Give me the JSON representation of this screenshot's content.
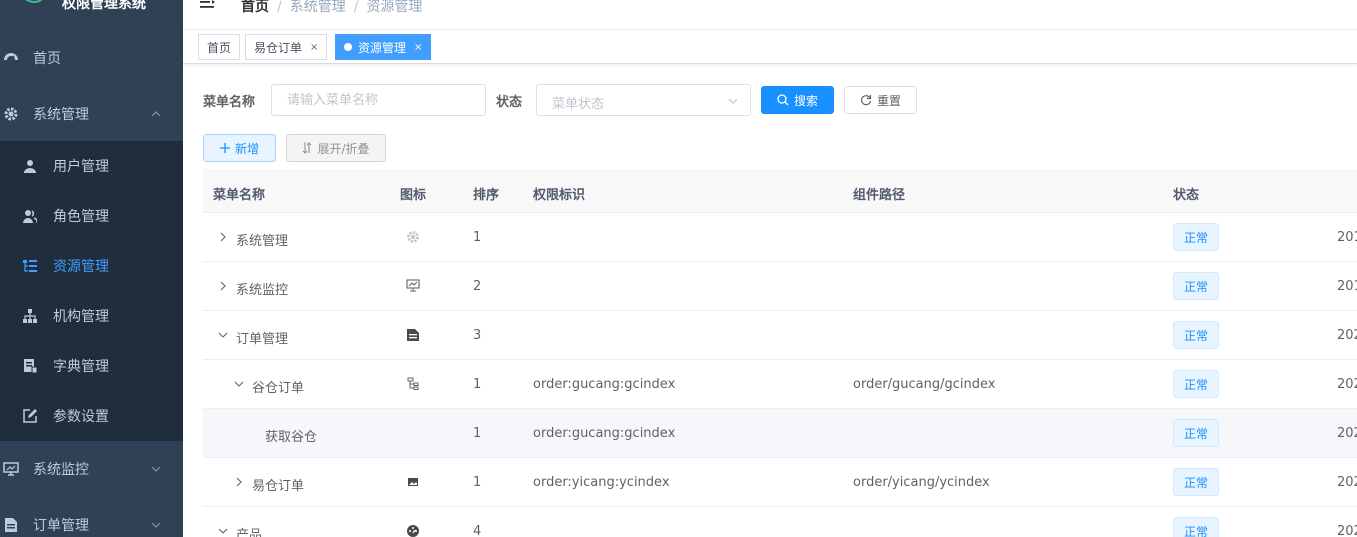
{
  "app": {
    "title": "权限管理系统"
  },
  "sidebar": {
    "items": [
      {
        "label": "首页",
        "icon": "dashboard-icon"
      },
      {
        "label": "系统管理",
        "icon": "gear-icon",
        "expanded": true
      },
      {
        "label": "系统监控",
        "icon": "monitor-icon"
      },
      {
        "label": "订单管理",
        "icon": "document-icon"
      }
    ],
    "submenu": [
      {
        "label": "用户管理",
        "icon": "user-icon"
      },
      {
        "label": "角色管理",
        "icon": "peoples-icon"
      },
      {
        "label": "资源管理",
        "icon": "tree-table-icon",
        "active": true
      },
      {
        "label": "机构管理",
        "icon": "tree-icon"
      },
      {
        "label": "字典管理",
        "icon": "dict-icon"
      },
      {
        "label": "参数设置",
        "icon": "edit-icon"
      }
    ]
  },
  "breadcrumb": [
    "首页",
    "系统管理",
    "资源管理"
  ],
  "tags": [
    {
      "label": "首页"
    },
    {
      "label": "易仓订单",
      "close": "×"
    },
    {
      "label": "资源管理",
      "close": "×",
      "active": true
    }
  ],
  "search": {
    "menu_name_label": "菜单名称",
    "menu_name_placeholder": "请输入菜单名称",
    "status_label": "状态",
    "status_placeholder": "菜单状态",
    "search_button": "搜索",
    "reset_button": "重置"
  },
  "toolbar": {
    "add_button": "新增",
    "expand_button": "展开/折叠"
  },
  "table": {
    "columns": [
      "菜单名称",
      "图标",
      "排序",
      "权限标识",
      "组件路径",
      "状态"
    ],
    "rows": [
      {
        "name": "系统管理",
        "level": 0,
        "expander": "collapsed",
        "icon": "gear-icon",
        "order": "1",
        "perms": "",
        "component": "",
        "status": "正常",
        "time": "201"
      },
      {
        "name": "系统监控",
        "level": 0,
        "expander": "collapsed",
        "icon": "monitor-icon",
        "order": "2",
        "perms": "",
        "component": "",
        "status": "正常",
        "time": "201"
      },
      {
        "name": "订单管理",
        "level": 0,
        "expander": "expanded",
        "icon": "document-icon",
        "order": "3",
        "perms": "",
        "component": "",
        "status": "正常",
        "time": "202"
      },
      {
        "name": "谷仓订单",
        "level": 1,
        "expander": "expanded",
        "icon": "tree-icon",
        "order": "1",
        "perms": "order:gucang:gcindex",
        "component": "order/gucang/gcindex",
        "status": "正常",
        "time": "202"
      },
      {
        "name": "获取谷仓",
        "level": 2,
        "expander": "none",
        "icon": "",
        "order": "1",
        "perms": "order:gucang:gcindex",
        "component": "",
        "status": "正常",
        "time": "202"
      },
      {
        "name": "易仓订单",
        "level": 1,
        "expander": "collapsed",
        "icon": "image-icon",
        "order": "1",
        "perms": "order:yicang:ycindex",
        "component": "order/yicang/ycindex",
        "status": "正常",
        "time": "202"
      },
      {
        "name": "产品",
        "level": 0,
        "expander": "expanded",
        "icon": "dashboard-icon",
        "order": "4",
        "perms": "",
        "component": "",
        "status": "正常",
        "time": "202"
      }
    ]
  },
  "colors": {
    "sidebar_bg": "#304156",
    "submenu_bg": "#1f2d3d",
    "primary": "#1890ff",
    "active_menu": "#409eff"
  }
}
